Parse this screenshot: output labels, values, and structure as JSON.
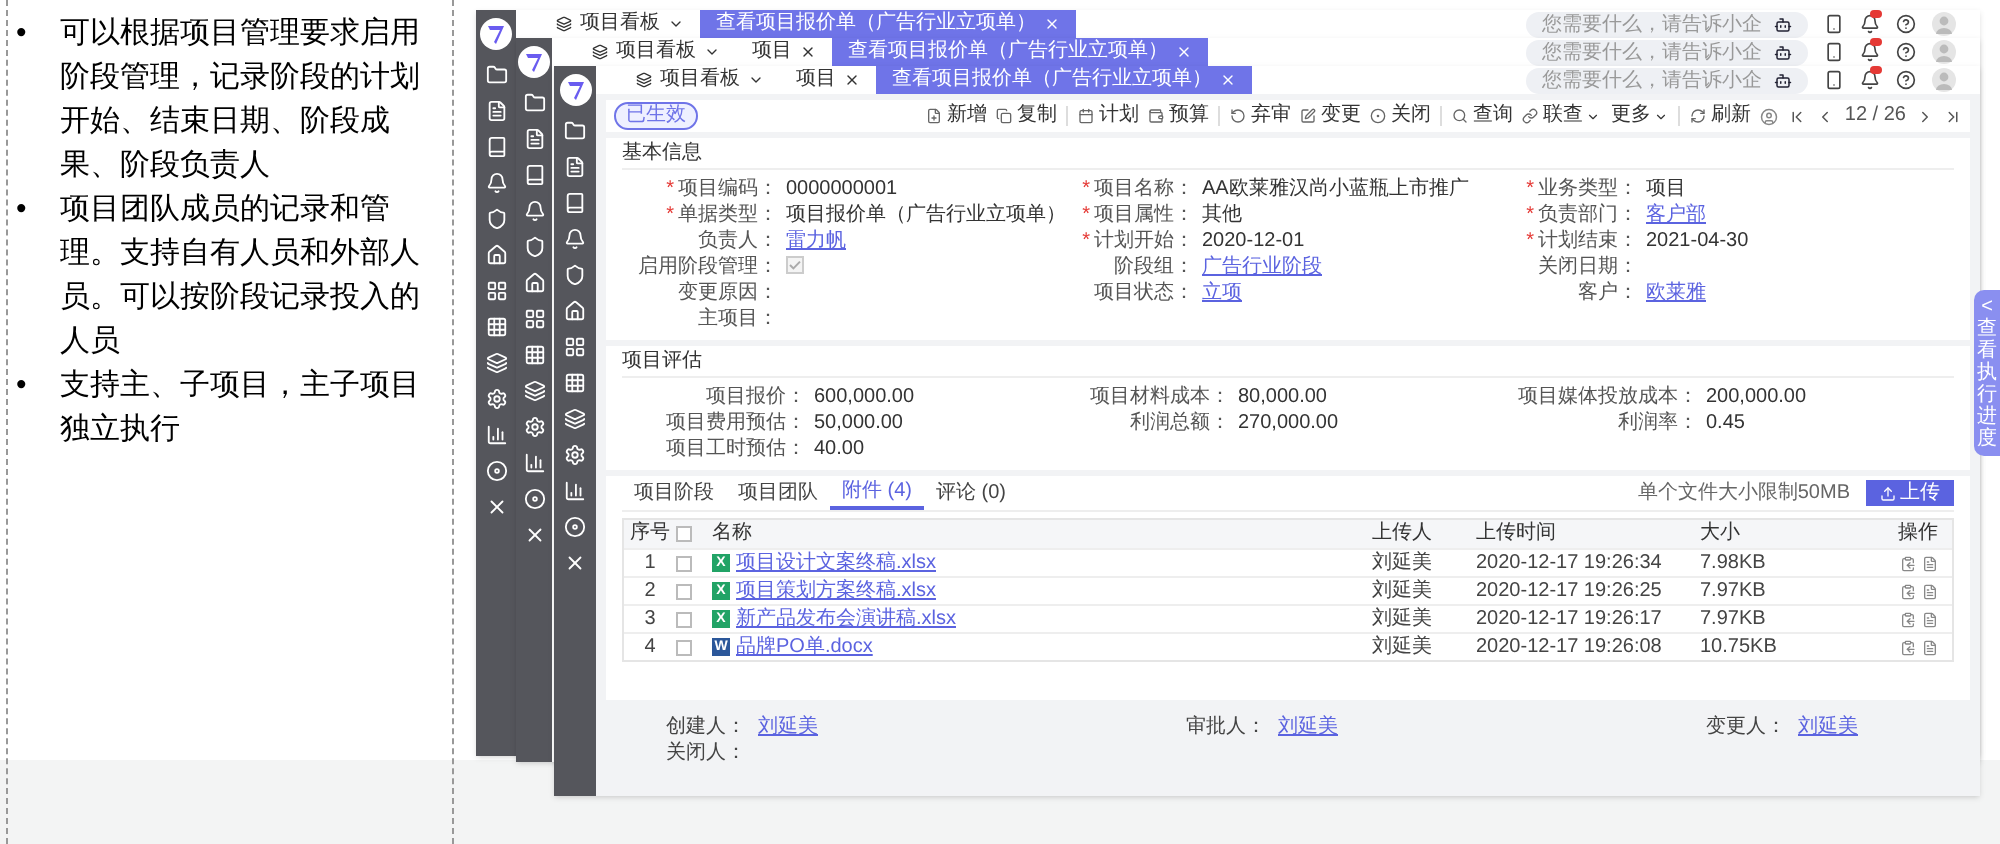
{
  "slide_bullets": [
    {
      "marker": "•",
      "text": "可以根据项目管理要求启用阶段管理，记录阶段的计划开始、结束日期、阶段成果、阶段负责人"
    },
    {
      "marker": "•",
      "text": "项目团队成员的记录和管理。支持自有人员和外部人员。可以按阶段记录投入的人员"
    },
    {
      "marker": "•",
      "text": "支持主、子项目，主子项目独立执行"
    }
  ],
  "windows": [
    {
      "tabs": [
        {
          "label": "项目看板",
          "kind": "menu",
          "selected": false
        },
        {
          "label": "查看项目报价单（广告行业立项单）",
          "kind": "page",
          "selected": true
        }
      ],
      "search": {
        "placeholder": "您需要什么，请告诉小企"
      }
    },
    {
      "tabs": [
        {
          "label": "项目看板",
          "kind": "menu",
          "selected": false
        },
        {
          "label": "项目",
          "kind": "page",
          "selected": false
        },
        {
          "label": "查看项目报价单（广告行业立项单）",
          "kind": "page",
          "selected": true
        }
      ],
      "search": {
        "placeholder": "您需要什么，请告诉小企"
      }
    },
    {
      "tabs": [
        {
          "label": "项目看板",
          "kind": "menu",
          "selected": false
        },
        {
          "label": "项目",
          "kind": "page",
          "selected": false
        },
        {
          "label": "查看项目报价单（广告行业立项单）",
          "kind": "page",
          "selected": true
        }
      ],
      "search": {
        "placeholder": "您需要什么，请告诉小企"
      }
    }
  ],
  "status_badge": "已生效",
  "toolbar": [
    [
      {
        "label": "新增"
      },
      {
        "label": "复制"
      }
    ],
    [
      {
        "label": "计划"
      },
      {
        "label": "预算"
      }
    ],
    [
      {
        "label": "弃审"
      },
      {
        "label": "变更"
      },
      {
        "label": "关闭"
      }
    ],
    [
      {
        "label": "查询"
      },
      {
        "label": "联查",
        "dropdown": true
      },
      {
        "label": "更多",
        "dropdown": true
      }
    ]
  ],
  "refresh": "刷新",
  "pager": "12 / 26",
  "basic_info": {
    "title": "基本信息",
    "columns": [
      [
        {
          "mark": "*",
          "label": "项目编码：",
          "kind": "text",
          "value": "0000000001"
        },
        {
          "mark": "*",
          "label": "单据类型：",
          "kind": "text",
          "value": "项目报价单（广告行业立项单）"
        },
        {
          "label": "负责人：",
          "kind": "link",
          "value": "雷力帆"
        },
        {
          "label": "启用阶段管理：",
          "kind": "checkbox",
          "checked": true
        },
        {
          "label": "变更原因：",
          "kind": "text"
        },
        {
          "label": "主项目：",
          "kind": "text"
        }
      ],
      [
        {
          "mark": "*",
          "label": "项目名称：",
          "kind": "text",
          "value": "AA欧莱雅汉尚小蓝瓶上市推广"
        },
        {
          "mark": "*",
          "label": "项目属性：",
          "kind": "text",
          "value": "其他"
        },
        {
          "mark": "*",
          "label": "计划开始：",
          "kind": "text",
          "value": "2020-12-01"
        },
        {
          "label": "阶段组：",
          "kind": "link",
          "value": "广告行业阶段"
        },
        {
          "label": "项目状态：",
          "kind": "link",
          "value": "立项"
        }
      ],
      [
        {
          "mark": "*",
          "label": "业务类型：",
          "kind": "text",
          "value": "项目"
        },
        {
          "mark": "*",
          "label": "负责部门：",
          "kind": "link",
          "value": "客户部"
        },
        {
          "mark": "*",
          "label": "计划结束：",
          "kind": "text",
          "value": "2021-04-30"
        },
        {
          "label": "关闭日期：",
          "kind": "text"
        },
        {
          "label": "客户：",
          "kind": "link",
          "value": "欧莱雅"
        }
      ]
    ]
  },
  "evaluation": {
    "title": "项目评估",
    "columns": [
      [
        {
          "label": "项目报价：",
          "value": "600,000.00"
        },
        {
          "label": "项目费用预估：",
          "value": "50,000.00"
        },
        {
          "label": "项目工时预估：",
          "value": "40.00"
        }
      ],
      [
        {
          "label": "项目材料成本：",
          "value": "80,000.00"
        },
        {
          "label": "利润总额：",
          "value": "270,000.00"
        }
      ],
      [
        {
          "label": "项目媒体投放成本：",
          "value": "200,000.00"
        },
        {
          "label": "利润率：",
          "value": "0.45"
        }
      ]
    ]
  },
  "detail_tabs": [
    {
      "label": "项目阶段",
      "selected": false
    },
    {
      "label": "项目团队",
      "selected": false
    },
    {
      "label": "附件 (4)",
      "selected": true
    },
    {
      "label": "评论 (0)",
      "selected": false
    }
  ],
  "upload_note": "单个文件大小限制50MB",
  "upload_button": "上传",
  "attachments": {
    "columns": [
      "序号",
      "名称",
      "上传人",
      "上传时间",
      "大小",
      "操作"
    ],
    "all_checked": false,
    "rows": [
      {
        "index": "1",
        "checked": false,
        "file_mark": "X",
        "color": "#21a366",
        "name": "项目设计文案终稿.xlsx",
        "uploader": "刘延美",
        "time": "2020-12-17 19:26:34",
        "size": "7.98KB"
      },
      {
        "index": "2",
        "checked": false,
        "file_mark": "X",
        "color": "#21a366",
        "name": "项目策划方案终稿.xlsx",
        "uploader": "刘延美",
        "time": "2020-12-17 19:26:25",
        "size": "7.97KB"
      },
      {
        "index": "3",
        "checked": false,
        "file_mark": "X",
        "color": "#21a366",
        "name": "新产品发布会演讲稿.xlsx",
        "uploader": "刘延美",
        "time": "2020-12-17 19:26:17",
        "size": "7.97KB"
      },
      {
        "index": "4",
        "checked": false,
        "file_mark": "W",
        "color": "#2b579a",
        "name": "品牌PO单.docx",
        "uploader": "刘延美",
        "time": "2020-12-17 19:26:08",
        "size": "10.75KB"
      }
    ]
  },
  "footer": [
    {
      "label": "创建人：",
      "value": "刘延美"
    },
    {
      "label": "审批人：",
      "value": "刘延美"
    },
    {
      "label": "变更人：",
      "value": "刘延美"
    },
    {
      "label": "关闭人："
    }
  ],
  "side_tab": {
    "arrow": "<",
    "text": "查看执行进度"
  }
}
